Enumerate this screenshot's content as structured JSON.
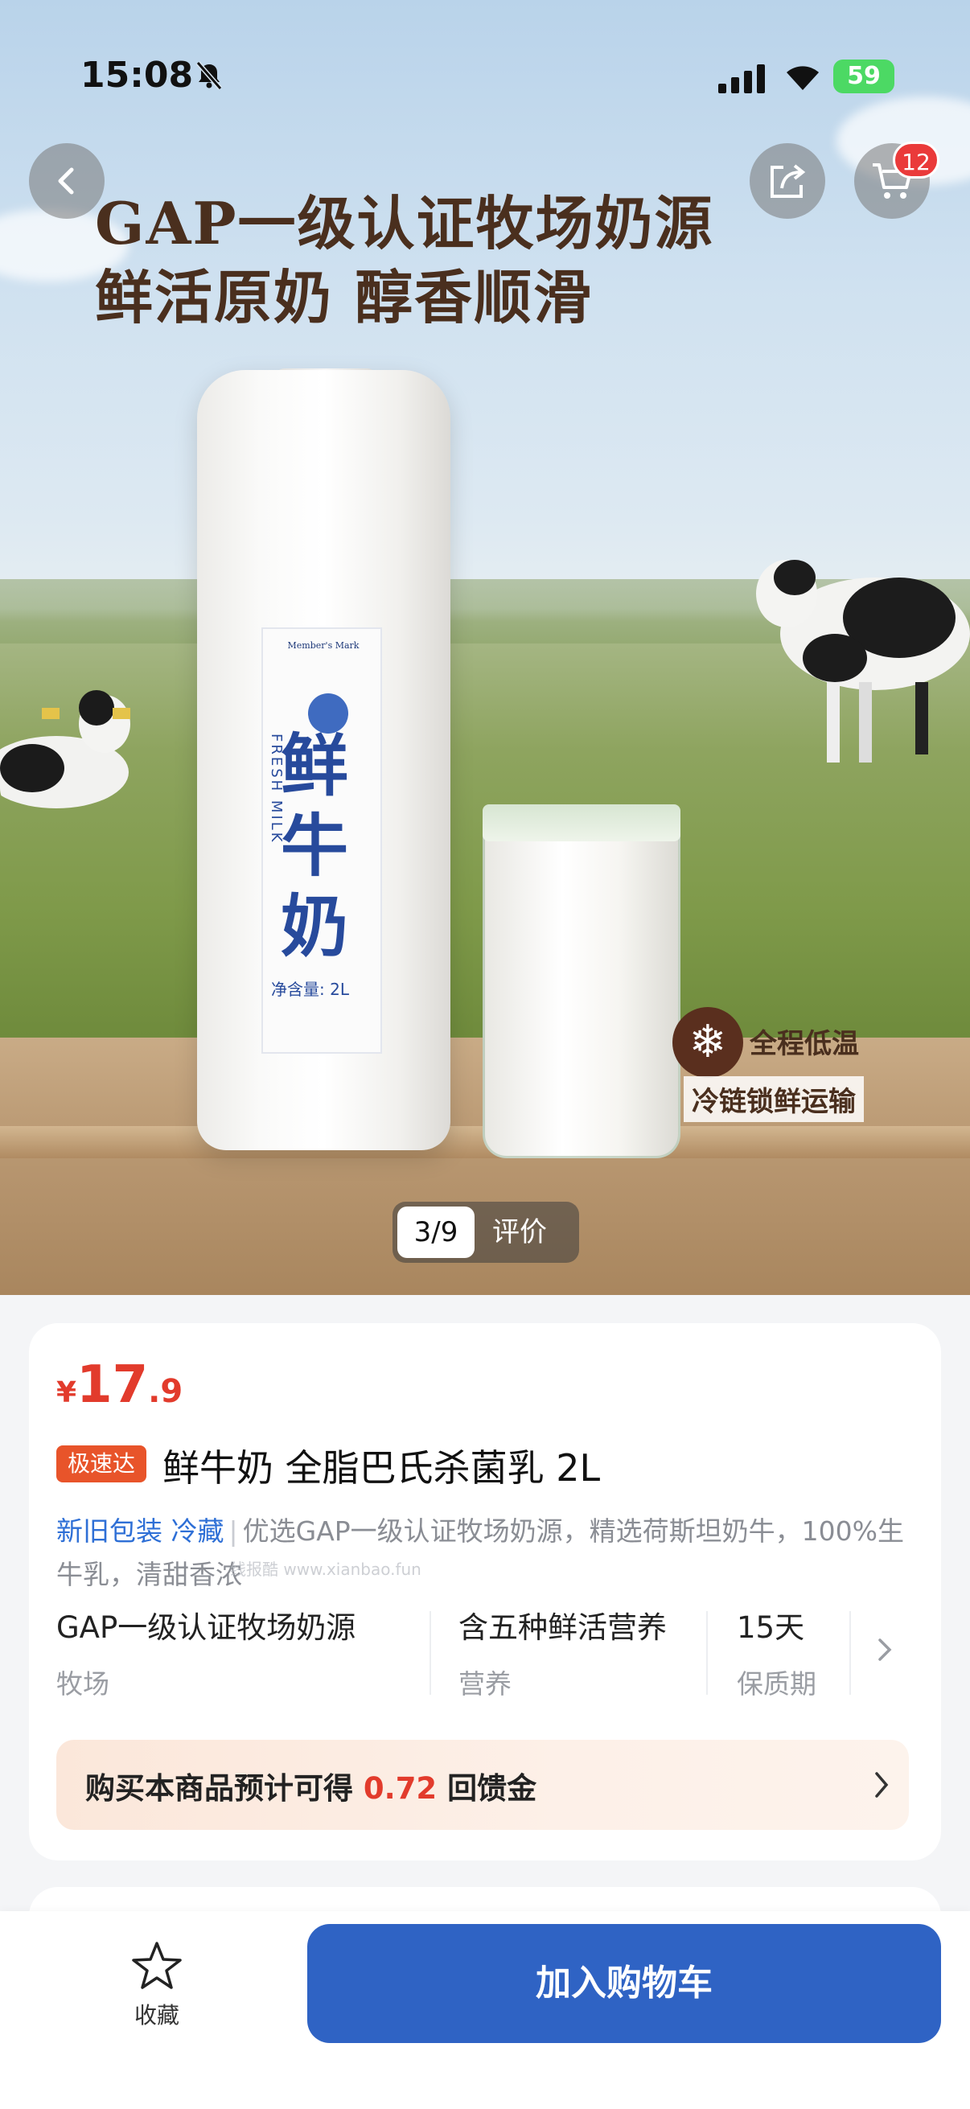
{
  "status_bar": {
    "time": "15:08",
    "battery": "59"
  },
  "hero": {
    "headline_line1": "GAP一级认证牧场奶源",
    "headline_line2": "鲜活原奶 醇香顺滑",
    "label_brand": "Member's Mark",
    "label_name": "鲜牛奶",
    "label_fresh": "FRESH MILK",
    "label_net": "净含量: 2L",
    "cold_line1": "全程低温",
    "cold_line2": "冷链锁鲜运输",
    "pager": "3/9",
    "review_label": "评价",
    "cart_badge": "12"
  },
  "product": {
    "currency": "¥",
    "price_int": "17",
    "price_dec": ".9",
    "express_tag": "极速达",
    "title": "鲜牛奶 全脂巴氏杀菌乳 2L",
    "tag1": "新旧包装",
    "tag2": "冷藏",
    "desc": "优选GAP一级认证牧场奶源，精选荷斯坦奶牛，100%生牛乳，清甜香浓",
    "watermark": "线报酷 www.xianbao.fun",
    "attrs": [
      {
        "value": "GAP一级认证牧场奶源",
        "key": "牧场"
      },
      {
        "value": "含五种鲜活营养",
        "key": "营养"
      },
      {
        "value": "15天",
        "key": "保质期"
      }
    ],
    "cashback_pre": "购买本商品预计可得",
    "cashback_amount": "0.72",
    "cashback_post": "回馈金"
  },
  "bottom": {
    "favorite": "收藏",
    "add_to_cart": "加入购物车"
  },
  "colors": {
    "price_red": "#e23b2c",
    "primary_blue": "#2f63c4",
    "express_orange": "#e8542a",
    "tag_blue": "#2e6fd6"
  }
}
